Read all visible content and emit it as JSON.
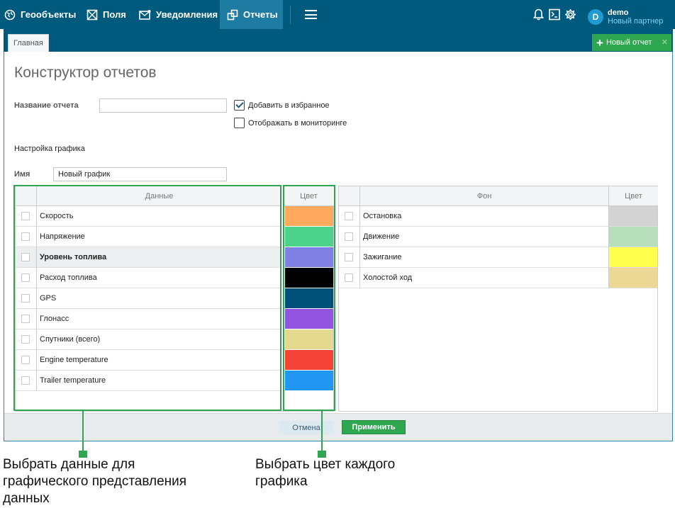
{
  "nav": {
    "items": [
      {
        "label": "Геообъекты",
        "icon": "globe-icon"
      },
      {
        "label": "Поля",
        "icon": "field-icon"
      },
      {
        "label": "Уведомления",
        "icon": "mail-icon"
      },
      {
        "label": "Отчеты",
        "icon": "report-icon"
      }
    ],
    "user": {
      "name": "demo",
      "org": "Новый партнер",
      "avatar_letter": "D"
    }
  },
  "tabs": {
    "home": "Главная",
    "new_report": "Новый отчет"
  },
  "page": {
    "title": "Конструктор отчетов"
  },
  "form": {
    "report_name_label": "Название отчета",
    "report_name_value": "",
    "add_favorites_label": "Добавить в избранное",
    "add_favorites_checked": true,
    "show_monitoring_label": "Отображать в мониторинге",
    "show_monitoring_checked": false,
    "chart_settings_label": "Настройка графика",
    "name_label": "Имя",
    "name_value": "Новый график"
  },
  "data_table": {
    "header_data": "Данные",
    "header_color": "Цвет",
    "rows": [
      {
        "label": "Скорость",
        "color": "#ffa95e",
        "selected": false
      },
      {
        "label": "Напряжение",
        "color": "#4dd28a",
        "selected": false
      },
      {
        "label": "Уровень топлива",
        "color": "#8080e4",
        "selected": true
      },
      {
        "label": "Расход топлива",
        "color": "#000000",
        "selected": false
      },
      {
        "label": "GPS",
        "color": "#004f78",
        "selected": false
      },
      {
        "label": "Глонасс",
        "color": "#9054e0",
        "selected": false
      },
      {
        "label": "Спутники (всего)",
        "color": "#e3d98f",
        "selected": false
      },
      {
        "label": "Engine temperature",
        "color": "#f44236",
        "selected": false
      },
      {
        "label": "Trailer temperature",
        "color": "#2196f3",
        "selected": false
      }
    ]
  },
  "bg_table": {
    "header_bg": "Фон",
    "header_color": "Цвет",
    "rows": [
      {
        "label": "Остановка",
        "color": "#d3d3d3"
      },
      {
        "label": "Движение",
        "color": "#b7dfbc"
      },
      {
        "label": "Зажигание",
        "color": "#ffff4d"
      },
      {
        "label": "Холостой ход",
        "color": "#ecd894"
      }
    ]
  },
  "footer": {
    "cancel": "Отмена",
    "apply": "Применить"
  },
  "captions": {
    "left_line1": "Выбрать данные для",
    "left_line2": "графического представления",
    "left_line3": "данных",
    "right_line1": "Выбрать цвет каждого",
    "right_line2": "графика"
  },
  "colors": {
    "topbar": "#005a7e",
    "active_nav": "#1e7ca3",
    "accent_green": "#2fa650"
  }
}
